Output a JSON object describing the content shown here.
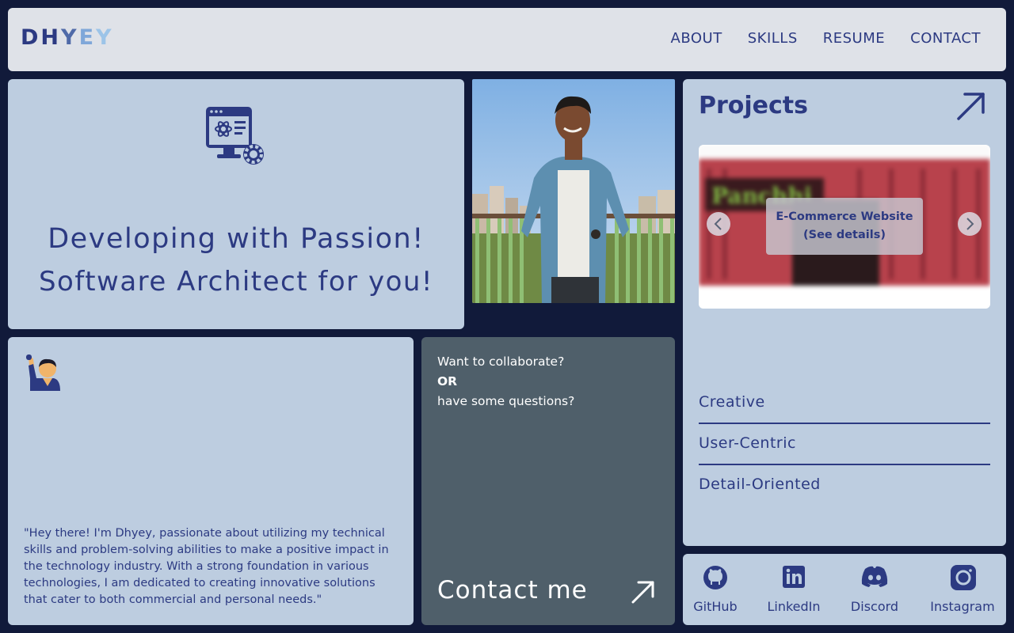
{
  "header": {
    "logo": {
      "l1": "DH",
      "l2": "Y",
      "l3": "E",
      "l4": "Y"
    },
    "nav": [
      "ABOUT",
      "SKILLS",
      "RESUME",
      "CONTACT"
    ]
  },
  "hero": {
    "line1": "Developing with Passion!",
    "line2": "Software Architect for you!"
  },
  "about": {
    "text": "\"Hey there! I'm Dhyey, passionate about utilizing my technical skills and problem-solving abilities to make a positive impact in the technology industry. With a strong foundation in various technologies, I am dedicated to creating innovative solutions that cater to both commercial and personal needs.\""
  },
  "contact": {
    "question1": "Want to collaborate?",
    "or": "OR",
    "question2": "have some questions?",
    "cta": "Contact me"
  },
  "projects": {
    "title": "Projects",
    "carousel": {
      "caption_line1": "E-Commerce Website",
      "caption_line2": "(See details)",
      "preview_brand": "Panchhi"
    },
    "traits": [
      "Creative",
      "User-Centric",
      "Detail-Oriented"
    ]
  },
  "socials": [
    {
      "label": "GitHub",
      "icon": "github-icon"
    },
    {
      "label": "LinkedIn",
      "icon": "linkedin-icon"
    },
    {
      "label": "Discord",
      "icon": "discord-icon"
    },
    {
      "label": "Instagram",
      "icon": "instagram-icon"
    }
  ],
  "colors": {
    "background": "#111a3a",
    "card": "#bdcde0",
    "header": "#dfe2e8",
    "accent": "#2c3a82",
    "contact_card": "#4f5f6a"
  }
}
